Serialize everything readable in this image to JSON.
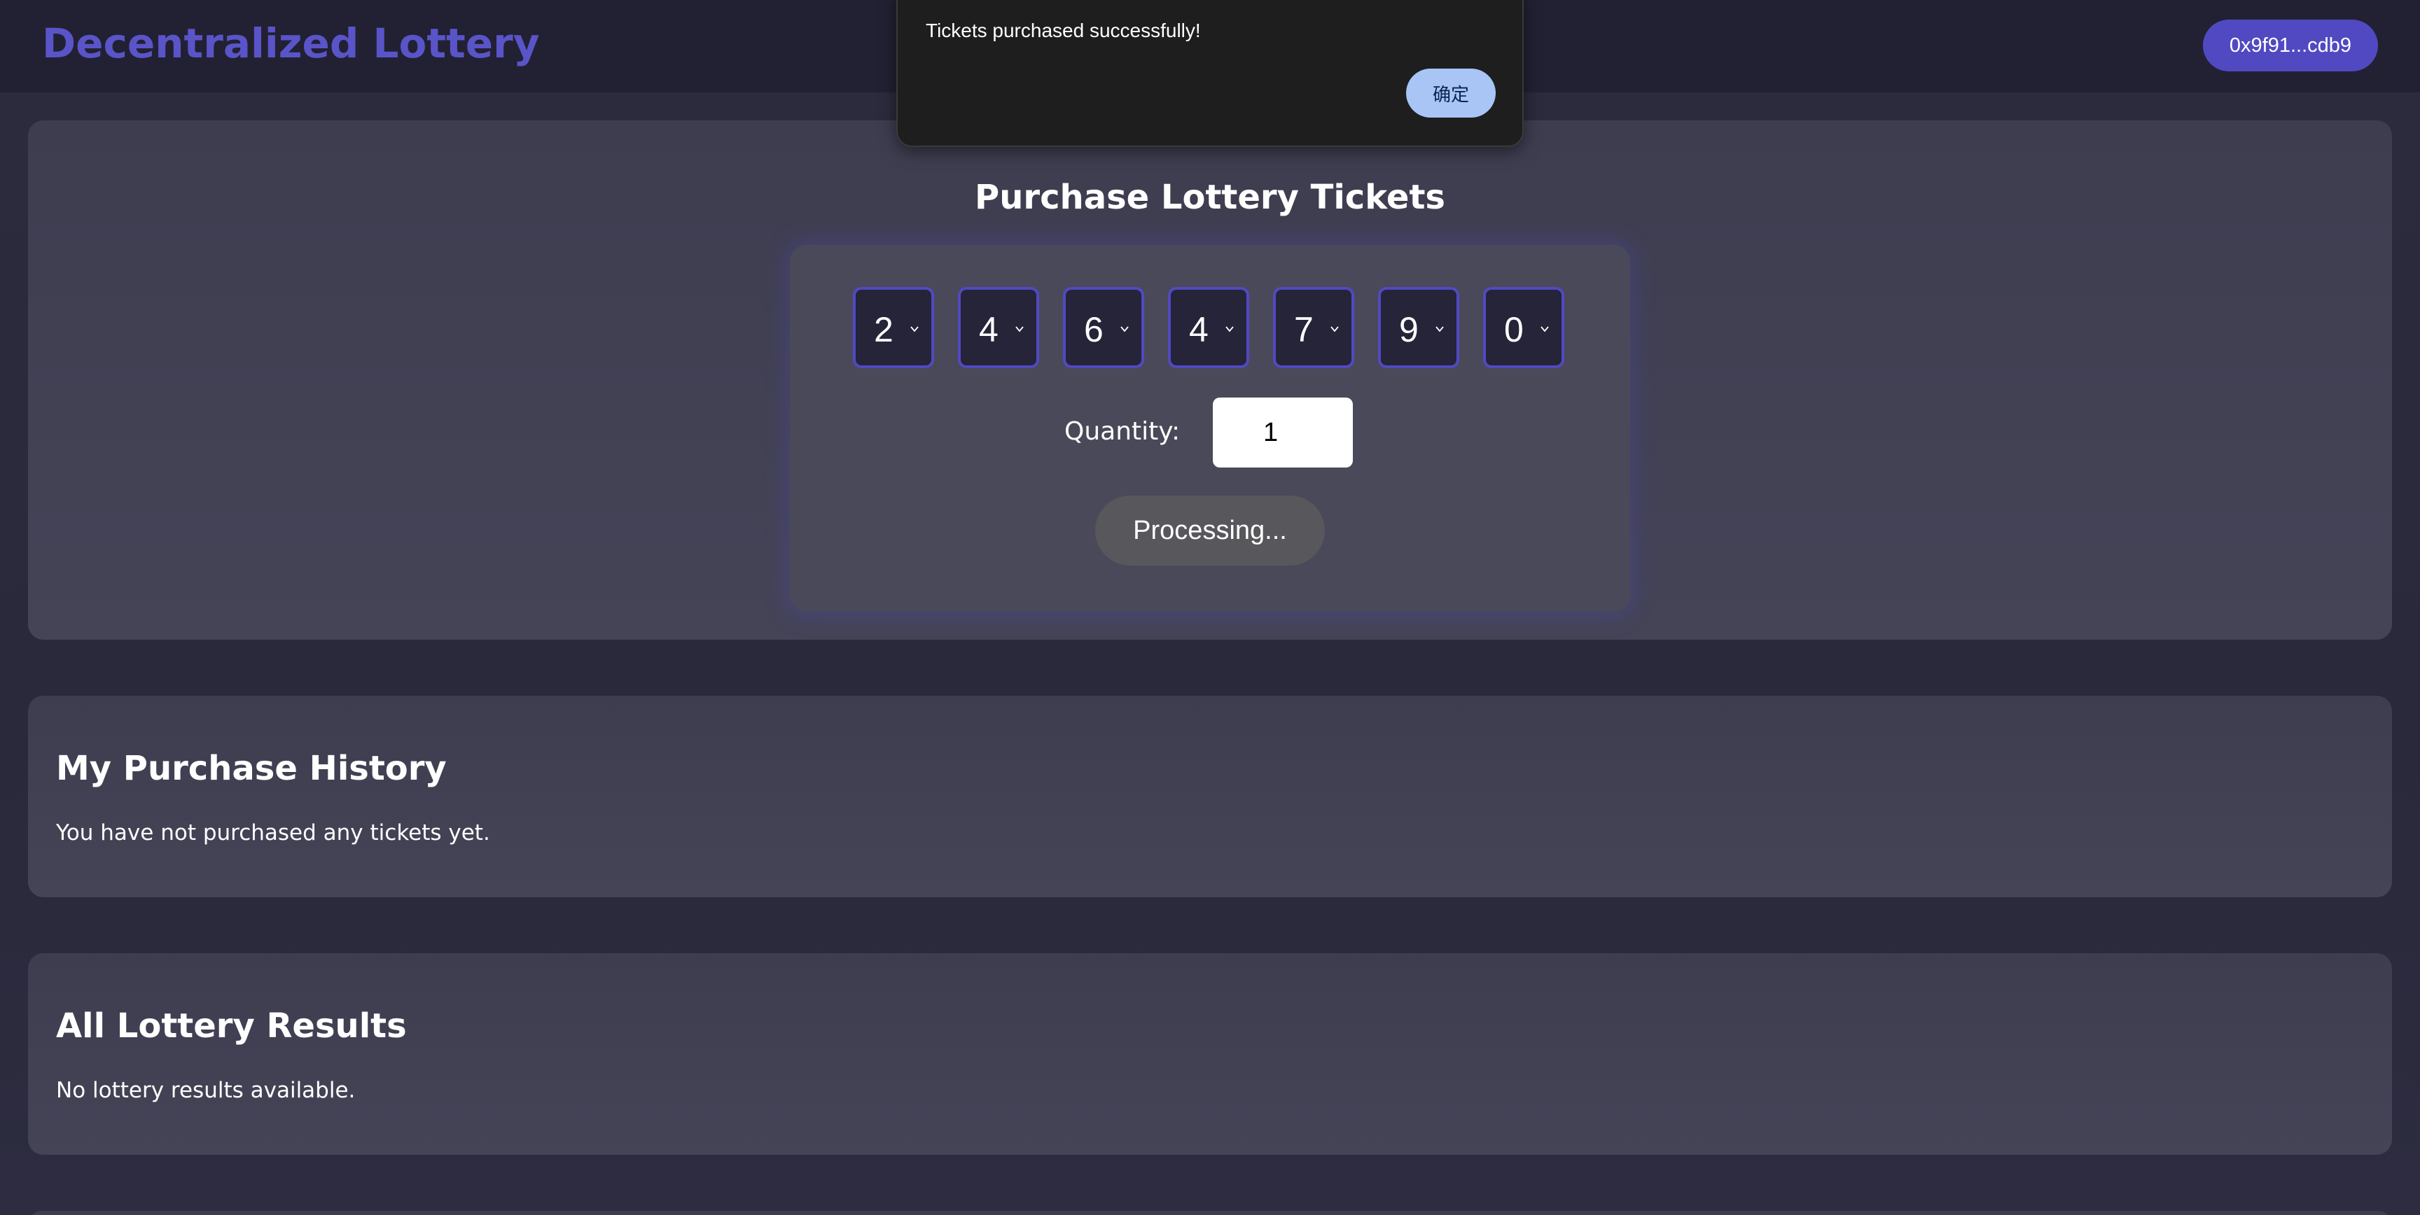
{
  "header": {
    "title": "Decentralized Lottery",
    "wallet_address": "0x9f91...cdb9"
  },
  "purchase": {
    "title": "Purchase Lottery Tickets",
    "numbers": [
      "2",
      "4",
      "6",
      "4",
      "7",
      "9",
      "0"
    ],
    "quantity_label": "Quantity:",
    "quantity_value": "1",
    "submit_label": "Processing..."
  },
  "history": {
    "title": "My Purchase History",
    "empty_text": "You have not purchased any tickets yet."
  },
  "results": {
    "title": "All Lottery Results",
    "empty_text": "No lottery results available."
  },
  "dialog": {
    "message": "Tickets purchased successfully!",
    "ok_label": "确定"
  },
  "icons": {
    "select_chevron": "chevron-down-icon"
  },
  "colors": {
    "accent": "#5149c2",
    "title": "#5a54c9",
    "dialog_button": "#a8c5f5"
  }
}
